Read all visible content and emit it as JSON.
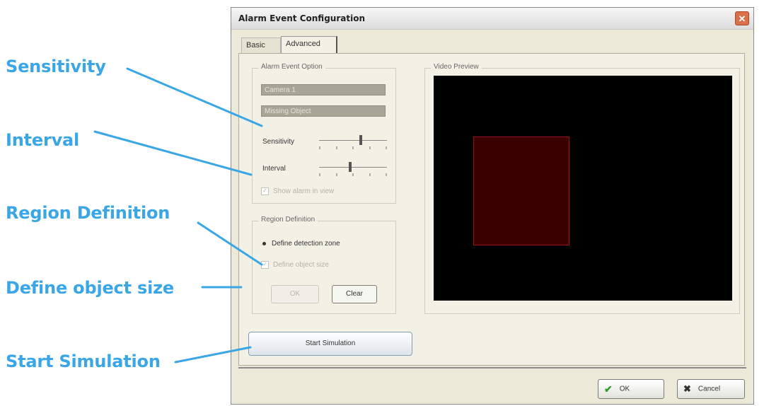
{
  "callouts": {
    "sensitivity": "Sensitivity",
    "interval": "Interval",
    "region_definition": "Region Definition",
    "define_object_size": "Define object size",
    "start_simulation": "Start Simulation"
  },
  "dialog": {
    "title": "Alarm Event Configuration",
    "close_glyph": "✕",
    "tabs": [
      {
        "label": "Basic",
        "active": false
      },
      {
        "label": "Advanced",
        "active": true
      }
    ],
    "alarm_group": {
      "label": "Alarm Event Option",
      "dropdown_1": "Camera 1",
      "dropdown_2": "Missing Object",
      "sensitivity_label": "Sensitivity",
      "sensitivity_level": 0.62,
      "interval_label": "Interval",
      "interval_level": 0.46,
      "checkbox_label": "Show alarm in view"
    },
    "region_group": {
      "label": "Region Definition",
      "radio_label": "Define detection zone",
      "checkbox_label": "Define object size",
      "ok_label": "OK",
      "clear_label": "Clear"
    },
    "preview": {
      "label": "Video Preview",
      "region_color": "#3a0000"
    },
    "start_simulation_label": "Start Simulation",
    "ok_label": "OK",
    "cancel_label": "Cancel"
  },
  "colors": {
    "callout": "#3aa6e6",
    "dialog_bg": "#ece9d8",
    "close_button": "#d9704a"
  }
}
